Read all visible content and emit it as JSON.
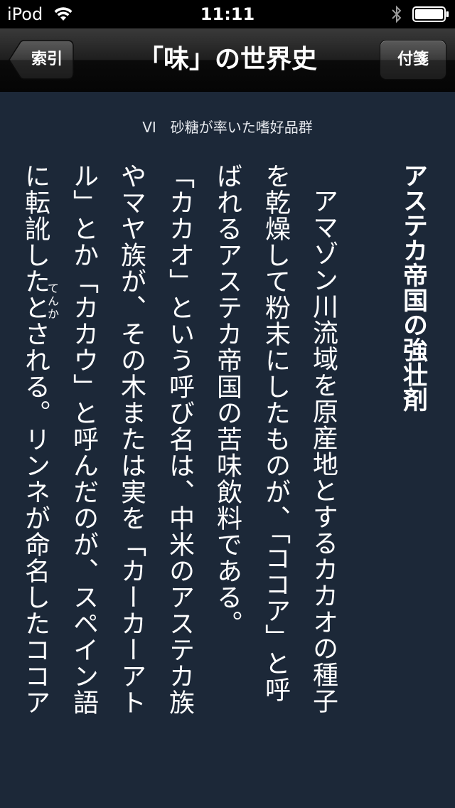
{
  "status_bar": {
    "carrier": "iPod",
    "time": "11:11"
  },
  "nav": {
    "back_label": "索引",
    "title": "「味」の世界史",
    "bookmark_label": "付箋"
  },
  "content": {
    "chapter": "VI　砂糖が率いた嗜好品群",
    "heading": "アステカ帝国の強壮剤",
    "columns": [
      "アマゾン川流域を原産地とするカカオの種子",
      "を乾燥して粉末にしたものが、「ココア」と呼",
      "ばれるアステカ帝国の苦味飲料である。",
      "「カカオ」という呼び名は、中米のアステカ族",
      "やマヤ族が、その木または実を「カーカーアト",
      "ル」とか「カカウ」と呼んだのが、スペイン語",
      "に転訛したとされる。リンネが命名したココア"
    ],
    "ruby": "てんか"
  }
}
